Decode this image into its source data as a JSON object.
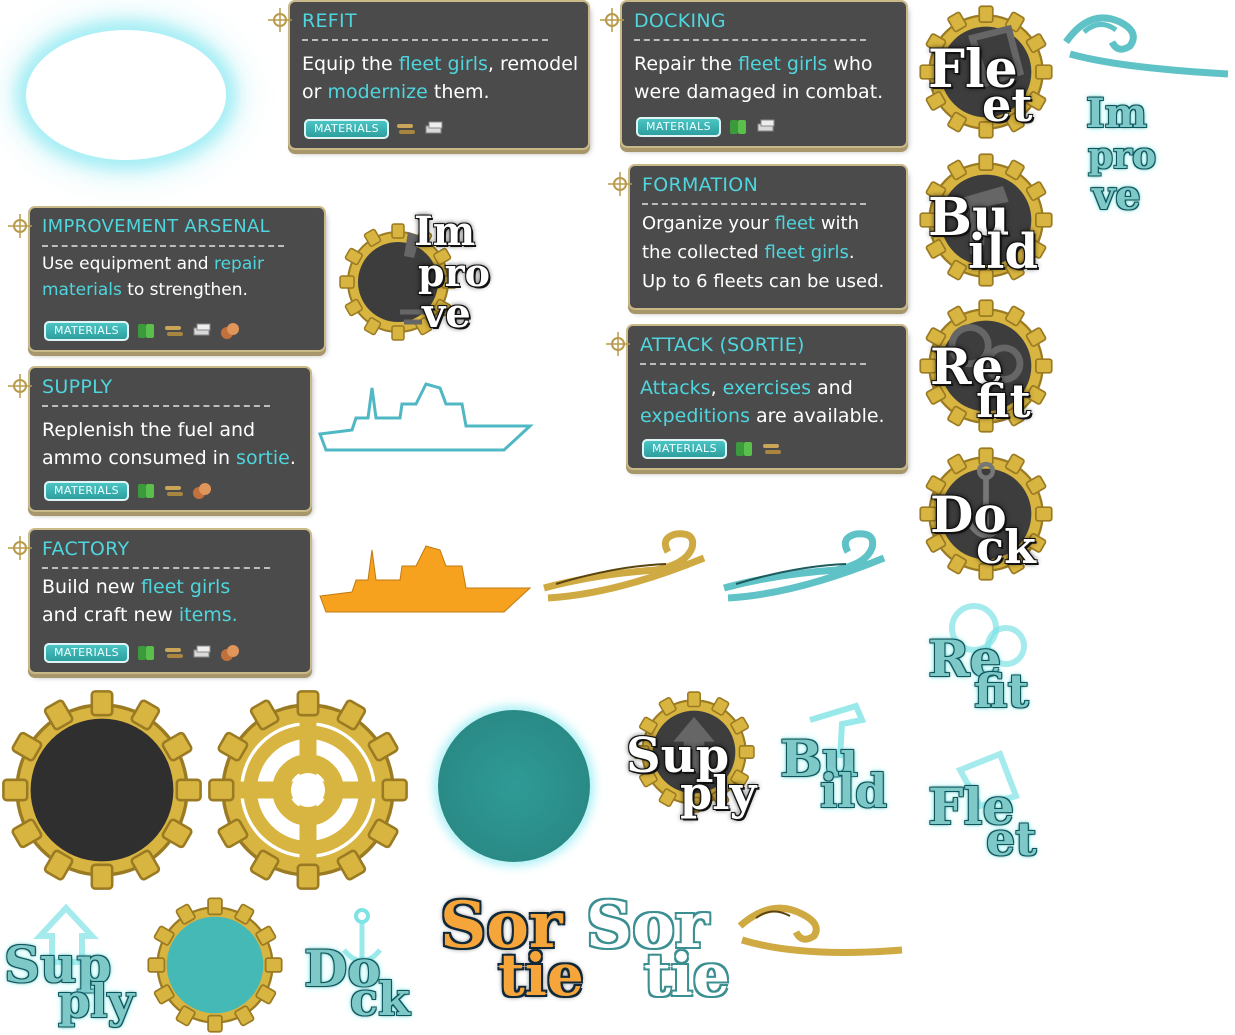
{
  "panels": {
    "refit": {
      "title": "REFIT",
      "line1": [
        "Equip the ",
        "fleet girls",
        ", remodel"
      ],
      "line2": [
        "or ",
        "modernize",
        " them."
      ],
      "materials": "MATERIALS"
    },
    "docking": {
      "title": "DOCKING",
      "line1": [
        "Repair the ",
        "fleet girls",
        " who"
      ],
      "line2": [
        "were damaged in combat."
      ],
      "materials": "MATERIALS"
    },
    "formation": {
      "title": "FORMATION",
      "line1": [
        "Organize your ",
        "fleet",
        " with"
      ],
      "line2": [
        "the collected ",
        "fleet girls",
        "."
      ],
      "line3": [
        "Up to 6 fleets can be used."
      ]
    },
    "improvement": {
      "title": "IMPROVEMENT ARSENAL",
      "line1": [
        "Use equipment and ",
        "repair"
      ],
      "line2": [
        "materials",
        " to strengthen."
      ],
      "materials": "MATERIALS"
    },
    "attack": {
      "title": "ATTACK (SORTIE)",
      "line1": [
        "Attacks",
        ", ",
        "exercises",
        " and"
      ],
      "line2": [
        "expeditions",
        " are available."
      ],
      "materials": "MATERIALS"
    },
    "supply": {
      "title": "SUPPLY",
      "line1": [
        "Replenish the fuel and"
      ],
      "line2": [
        "ammo consumed in ",
        "sortie",
        "."
      ],
      "materials": "MATERIALS"
    },
    "factory": {
      "title": "FACTORY",
      "line1": [
        "Build new ",
        "fleet girls"
      ],
      "line2": [
        "and craft new ",
        "items."
      ],
      "materials": "MATERIALS"
    }
  },
  "icons": {
    "fleet": [
      "Fle",
      "et"
    ],
    "improve": [
      "Im",
      "pro",
      "ve"
    ],
    "build": [
      "Bu",
      "ild"
    ],
    "refit": [
      "Re",
      "fit"
    ],
    "dock": [
      "Do",
      "ck"
    ],
    "supply": [
      "Sup",
      "ply"
    ],
    "sortie": [
      "Sor",
      "tie"
    ]
  },
  "colors": {
    "accent": "#4fd5dd",
    "panel": "#4b4b4b",
    "gold": "#d8b440",
    "teal_disc": "#2a8a86",
    "ship_orange": "#f7a21f",
    "ship_outline": "#4fb8c4"
  }
}
